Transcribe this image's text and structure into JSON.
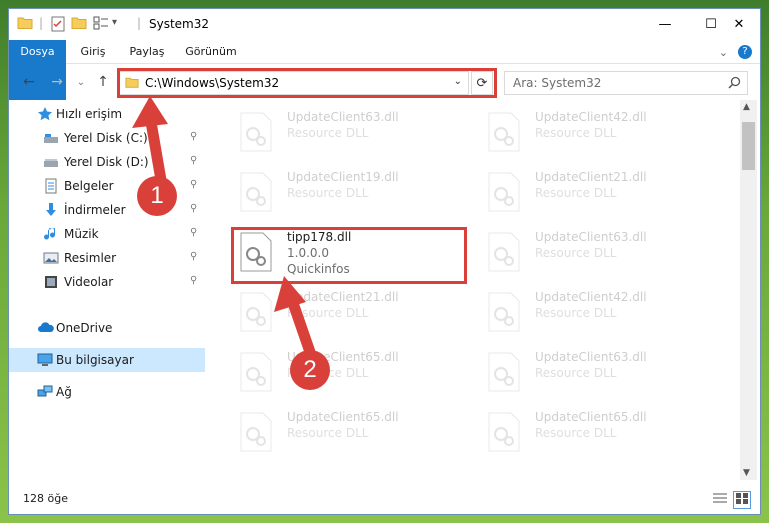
{
  "window": {
    "title": "System32",
    "controls": {
      "minimize": "—",
      "maximize": "☐",
      "close": "✕"
    }
  },
  "ribbon": {
    "tabs": [
      {
        "label": "Dosya"
      },
      {
        "label": "Giriş"
      },
      {
        "label": "Paylaş"
      },
      {
        "label": "Görünüm"
      }
    ],
    "expand": "⌄",
    "help": "?"
  },
  "nav": {
    "back": "←",
    "forward": "→",
    "recent": "⌄",
    "up": "↑",
    "path": "C:\\Windows\\System32",
    "path_dropdown": "⌄",
    "refresh": "⟳"
  },
  "search": {
    "placeholder": "Ara: System32"
  },
  "sidebar": {
    "items": [
      {
        "label": "Hızlı erişim",
        "icon": "star-icon"
      },
      {
        "label": "Yerel Disk (C:)",
        "icon": "drive-icon",
        "pinned": true
      },
      {
        "label": "Yerel Disk (D:)",
        "icon": "drive-icon",
        "pinned": true
      },
      {
        "label": "Belgeler",
        "icon": "documents-icon",
        "pinned": true
      },
      {
        "label": "İndirmeler",
        "icon": "download-icon",
        "pinned": true
      },
      {
        "label": "Müzik",
        "icon": "music-icon",
        "pinned": true
      },
      {
        "label": "Resimler",
        "icon": "pictures-icon",
        "pinned": true
      },
      {
        "label": "Videolar",
        "icon": "videos-icon",
        "pinned": true
      },
      {
        "label": "OneDrive",
        "icon": "onedrive-icon"
      },
      {
        "label": "Bu bilgisayar",
        "icon": "computer-icon",
        "selected": true
      },
      {
        "label": "Ağ",
        "icon": "network-icon"
      }
    ],
    "pin_glyph": "📌"
  },
  "files": [
    {
      "name": "UpdateClient63.dll",
      "desc": "Resource DLL"
    },
    {
      "name": "UpdateClient42.dll",
      "desc": "Resource DLL"
    },
    {
      "name": "UpdateClient19.dll",
      "desc": "Resource DLL"
    },
    {
      "name": "UpdateClient21.dll",
      "desc": "Resource DLL"
    },
    {
      "name": "tipp178.dll",
      "version": "1.0.0.0",
      "desc": "Quickinfos"
    },
    {
      "name": "UpdateClient63.dll",
      "desc": "Resource DLL"
    },
    {
      "name": "UpdateClient21.dll",
      "desc": "Resource DLL"
    },
    {
      "name": "UpdateClient42.dll",
      "desc": "Resource DLL"
    },
    {
      "name": "UpdateClient65.dll",
      "desc": "Resource DLL"
    },
    {
      "name": "UpdateClient63.dll",
      "desc": "Resource DLL"
    },
    {
      "name": "UpdateClient65.dll",
      "desc": "Resource DLL"
    },
    {
      "name": "UpdateClient65.dll",
      "desc": "Resource DLL"
    }
  ],
  "status": {
    "count": "128 öğe"
  },
  "callouts": {
    "step1": "1",
    "step2": "2"
  },
  "colors": {
    "accent": "#1979ca",
    "highlight": "#d9403a",
    "selected": "#cce8ff"
  }
}
